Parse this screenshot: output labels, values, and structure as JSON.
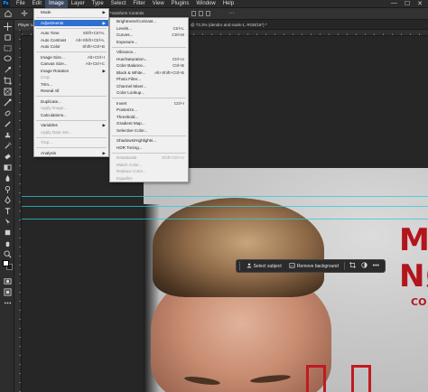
{
  "menubar": {
    "logo": "Ps",
    "items": [
      "File",
      "Edit",
      "Image",
      "Layer",
      "Type",
      "Select",
      "Filter",
      "View",
      "Plugins",
      "Window",
      "Help"
    ],
    "active_index": 2,
    "window_controls": [
      "—",
      "☐",
      "✕"
    ]
  },
  "options_bar": {
    "transform_label": "Transform Controls"
  },
  "document": {
    "tab_label": "Player card",
    "tab2_label": "@ 73.3% (dendro and soals-1, RGB/16*) *"
  },
  "poster": {
    "line1": "MA",
    "line2": "NØ",
    "line3": "CO"
  },
  "contextual_bar": {
    "select_subject": "Select subject",
    "remove_background": "Remove background",
    "more": "•••"
  },
  "image_menu": {
    "rows": [
      {
        "label": "Mode",
        "submenu": true
      },
      {
        "sep": true
      },
      {
        "label": "Adjustments",
        "submenu": true,
        "highlight": true
      },
      {
        "sep": true
      },
      {
        "label": "Auto Tone",
        "shortcut": "Shift+Ctrl+L"
      },
      {
        "label": "Auto Contrast",
        "shortcut": "Alt+Shift+Ctrl+L"
      },
      {
        "label": "Auto Color",
        "shortcut": "Shift+Ctrl+B"
      },
      {
        "sep": true
      },
      {
        "label": "Image Size...",
        "shortcut": "Alt+Ctrl+I"
      },
      {
        "label": "Canvas Size...",
        "shortcut": "Alt+Ctrl+C"
      },
      {
        "label": "Image Rotation",
        "submenu": true
      },
      {
        "label": "Crop",
        "disabled": true
      },
      {
        "label": "Trim..."
      },
      {
        "label": "Reveal All"
      },
      {
        "sep": true
      },
      {
        "label": "Duplicate..."
      },
      {
        "label": "Apply Image...",
        "disabled": true
      },
      {
        "label": "Calculations..."
      },
      {
        "sep": true
      },
      {
        "label": "Variables",
        "submenu": true
      },
      {
        "label": "Apply Data Set...",
        "disabled": true
      },
      {
        "sep": true
      },
      {
        "label": "Trap...",
        "disabled": true
      },
      {
        "sep": true
      },
      {
        "label": "Analysis",
        "submenu": true
      }
    ]
  },
  "adjustments_menu": {
    "rows": [
      {
        "label": "Brightness/Contrast..."
      },
      {
        "label": "Levels...",
        "shortcut": "Ctrl+L"
      },
      {
        "label": "Curves...",
        "shortcut": "Ctrl+M"
      },
      {
        "label": "Exposure..."
      },
      {
        "sep": true
      },
      {
        "label": "Vibrance..."
      },
      {
        "label": "Hue/Saturation...",
        "shortcut": "Ctrl+U"
      },
      {
        "label": "Color Balance...",
        "shortcut": "Ctrl+B"
      },
      {
        "label": "Black & White...",
        "shortcut": "Alt+Shift+Ctrl+B"
      },
      {
        "label": "Photo Filter..."
      },
      {
        "label": "Channel Mixer..."
      },
      {
        "label": "Color Lookup..."
      },
      {
        "sep": true
      },
      {
        "label": "Invert",
        "shortcut": "Ctrl+I"
      },
      {
        "label": "Posterize..."
      },
      {
        "label": "Threshold..."
      },
      {
        "label": "Gradient Map..."
      },
      {
        "label": "Selective Color..."
      },
      {
        "sep": true
      },
      {
        "label": "Shadows/Highlights..."
      },
      {
        "label": "HDR Toning..."
      },
      {
        "sep": true
      },
      {
        "label": "Desaturate",
        "shortcut": "Shift+Ctrl+U",
        "disabled": true
      },
      {
        "label": "Match Color...",
        "disabled": true
      },
      {
        "label": "Replace Color...",
        "disabled": true
      },
      {
        "label": "Equalize",
        "disabled": true
      }
    ]
  },
  "colors": {
    "accent": "#2d6fd0",
    "poster_red": "#b3151d",
    "guide": "#2ec9d6"
  }
}
